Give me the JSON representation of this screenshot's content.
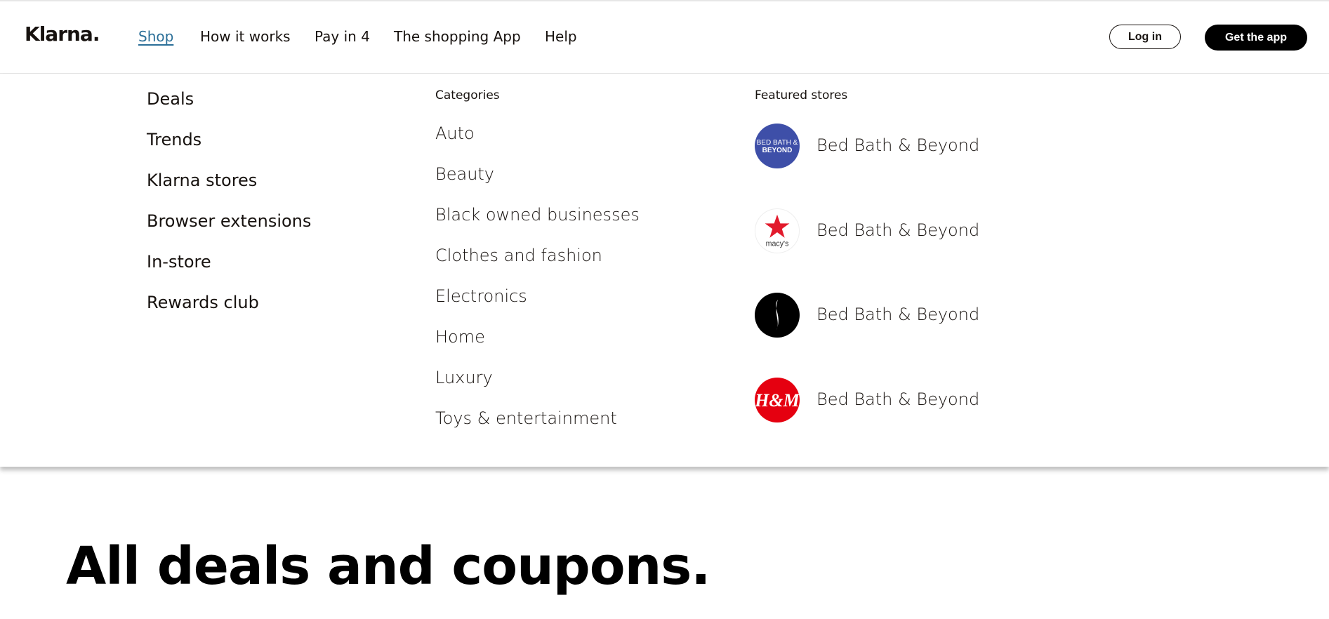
{
  "header": {
    "logo": "Klarna.",
    "nav": [
      "Shop",
      "How it works",
      "Pay in 4",
      "The shopping App",
      "Help"
    ],
    "login_label": "Log in",
    "app_label": "Get the app"
  },
  "menu": {
    "main_items": [
      "Deals",
      "Trends",
      "Klarna stores",
      "Browser extensions",
      "In-store",
      "Rewards club"
    ],
    "categories_heading": "Categories",
    "categories": [
      "Auto",
      "Beauty",
      "Black owned businesses",
      "Clothes and fashion",
      "Electronics",
      "Home",
      "Luxury",
      "Toys & entertainment"
    ],
    "featured_heading": "Featured stores",
    "stores": [
      {
        "name": "Bed Bath & Beyond",
        "logo_text": "BED BATH & BEYOND",
        "icon": "bed-bath-beyond-logo",
        "color": "#3e4fa8"
      },
      {
        "name": "Bed Bath & Beyond",
        "logo_text": "macy's",
        "icon": "macys-star-logo",
        "color": "#e21a2c"
      },
      {
        "name": "Bed Bath & Beyond",
        "logo_text": "",
        "icon": "sephora-flame-logo",
        "color": "#000000"
      },
      {
        "name": "Bed Bath & Beyond",
        "logo_text": "H&M",
        "icon": "hm-logo",
        "color": "#e50010"
      }
    ]
  },
  "hero": {
    "title": "All deals and coupons."
  },
  "colors": {
    "accent_link": "#2b6f98",
    "text": "#17120f"
  }
}
